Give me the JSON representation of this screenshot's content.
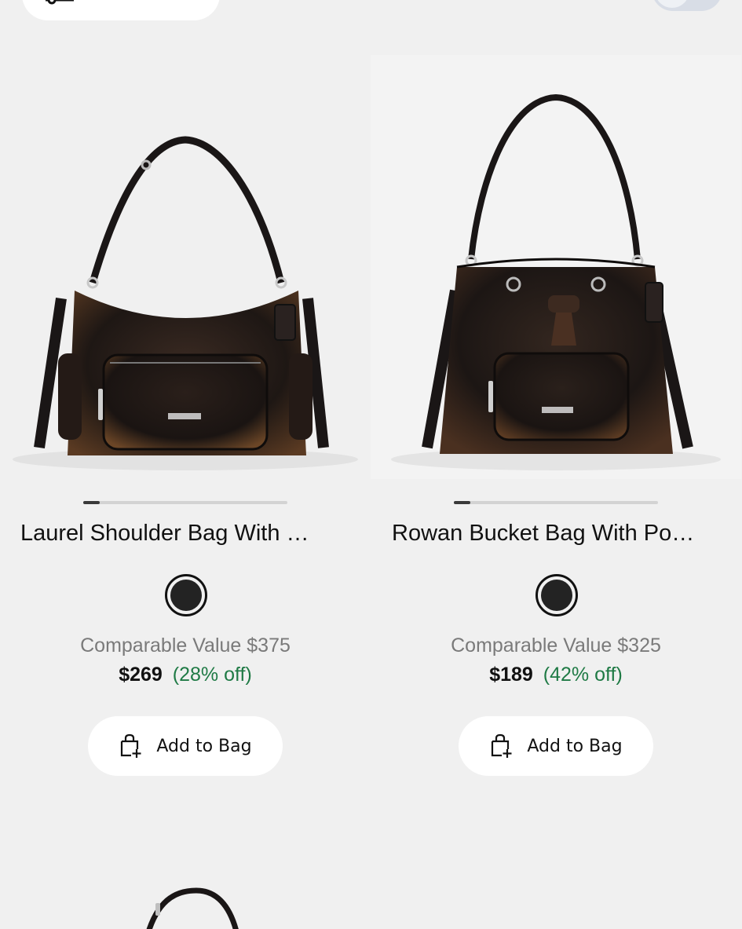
{
  "top_bar": {
    "filter_icon": "filter-icon",
    "toggle_icon": "toggle-switch"
  },
  "products": [
    {
      "name": "Laurel Shoulder Bag With …",
      "image": "black leather shoulder bag with front zip pocket",
      "color_swatch": "#232323",
      "comparable_value": "Comparable Value $375",
      "price": "$269",
      "discount": "(28% off)",
      "add_to_bag_label": "Add to Bag",
      "carousel_progress": 0.08
    },
    {
      "name": "Rowan Bucket Bag With Po…",
      "image": "black leather drawstring bucket bag with front pocket",
      "color_swatch": "#232323",
      "comparable_value": "Comparable Value $325",
      "price": "$189",
      "discount": "(42% off)",
      "add_to_bag_label": "Add to Bag",
      "carousel_progress": 0.08
    }
  ],
  "colors": {
    "background": "#f0f0f0",
    "discount": "#1f7a45",
    "comparable": "#7a7a7a"
  }
}
